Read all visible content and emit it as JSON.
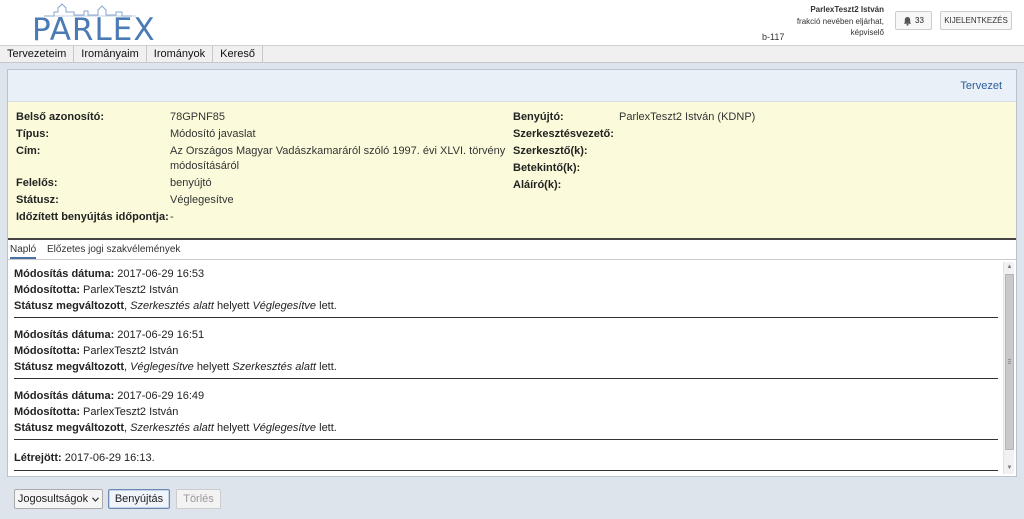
{
  "header": {
    "logo_text": "PARLEX",
    "user_name": "ParlexTeszt2 István",
    "user_role": "frakció nevében eljárhat, képviselő",
    "user_code": "b-117",
    "notification_count": "33",
    "logout_label": "KIJELENTKEZÉS"
  },
  "menu": {
    "items": [
      {
        "label": "Tervezeteim"
      },
      {
        "label": "Irományaim"
      },
      {
        "label": "Irományok"
      },
      {
        "label": "Kereső"
      }
    ]
  },
  "panel": {
    "head_link": "Tervezet",
    "left": [
      {
        "label": "Belső azonosító:",
        "value": "78GPNF85"
      },
      {
        "label": "Típus:",
        "value": "Módosító javaslat"
      },
      {
        "label": "Cím:",
        "value": "Az Országos Magyar Vadászkamaráról szóló 1997. évi XLVI. törvény",
        "value2": "módosításáról"
      },
      {
        "label": "Felelős:",
        "value": "benyújtó"
      },
      {
        "label": "Státusz:",
        "value": "Véglegesítve"
      },
      {
        "label": "Időzített benyújtás időpontja:",
        "value": "-"
      }
    ],
    "right": [
      {
        "label": "Benyújtó:",
        "value": "ParlexTeszt2 István (KDNP)"
      },
      {
        "label": "Szerkesztésvezető:",
        "value": ""
      },
      {
        "label": "Szerkesztő(k):",
        "value": ""
      },
      {
        "label": "Betekintő(k):",
        "value": ""
      },
      {
        "label": "Aláíró(k):",
        "value": ""
      }
    ]
  },
  "tabs": [
    {
      "label": "Napló"
    },
    {
      "label": "Előzetes jogi szakvélemények"
    }
  ],
  "log": {
    "date_label": "Módosítás dátuma:",
    "by_label": "Módosította:",
    "status_label": "Státusz megváltozott",
    "instead": "helyett",
    "became": "lett.",
    "entries": [
      {
        "date": "2017-06-29 16:53",
        "by": "ParlexTeszt2 István",
        "from": "Szerkesztés alatt",
        "to": "Véglegesítve"
      },
      {
        "date": "2017-06-29 16:51",
        "by": "ParlexTeszt2 István",
        "from": "Véglegesítve",
        "to": "Szerkesztés alatt"
      },
      {
        "date": "2017-06-29 16:49",
        "by": "ParlexTeszt2 István",
        "from": "Szerkesztés alatt",
        "to": "Véglegesítve"
      }
    ],
    "created_label": "Létrejött:",
    "created_value": "2017-06-29 16:13."
  },
  "footer": {
    "permissions_label": "Jogosultságok",
    "submit_label": "Benyújtás",
    "delete_label": "Törlés"
  },
  "icons": {
    "notification": "bell-icon",
    "dropdown": "chevron-down-icon"
  },
  "colors": {
    "brand": "#4a7bb5",
    "info_bg": "#fbfbdc",
    "link": "#2b5d9a"
  }
}
